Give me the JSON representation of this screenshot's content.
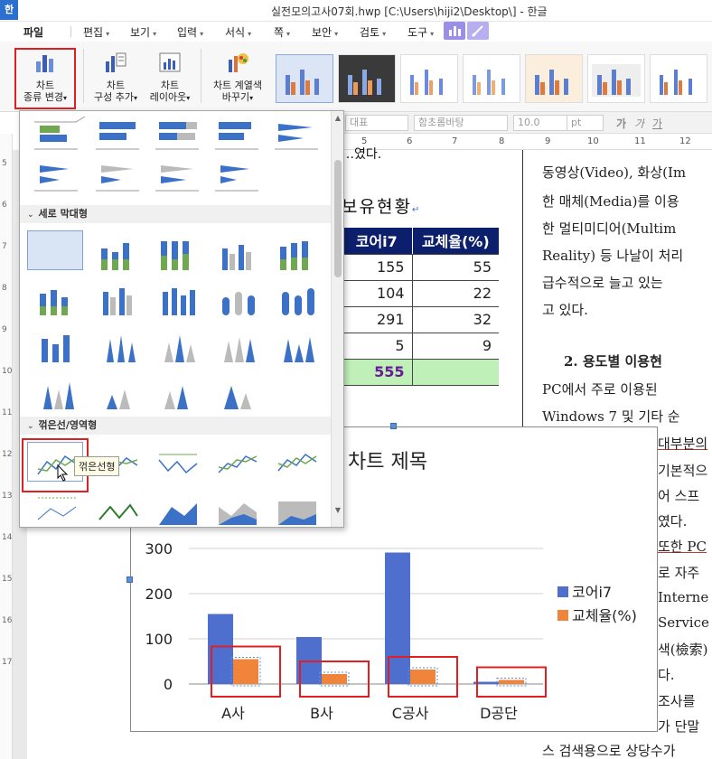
{
  "window": {
    "app_logo": "한",
    "title": "실전모의고사07회.hwp [C:\\Users\\hiji2\\Desktop\\] - 한글"
  },
  "menu": {
    "file": "파일",
    "items": [
      "편집",
      "보기",
      "입력",
      "서식",
      "쪽",
      "보안",
      "검토",
      "도구"
    ]
  },
  "ribbon": {
    "change_chart_type": "차트\n종류 변경",
    "add_component": "차트\n구성 추가",
    "layout": "차트\n레이아웃",
    "change_color": "차트 계열색\n바꾸기"
  },
  "format_bar": {
    "style": "대표",
    "font": "함초롬바탕",
    "size": "10.0",
    "unit": "pt",
    "glyphs": [
      "가",
      "가",
      "가"
    ]
  },
  "ruler": {
    "numbers": [
      "5",
      "6",
      "7",
      "8",
      "9",
      "10",
      "11",
      "12"
    ],
    "left_numbers": [
      "5",
      "6",
      "7",
      "8",
      "9",
      "10",
      "11",
      "12",
      "13",
      "14",
      "15",
      "16",
      "17"
    ]
  },
  "dropdown": {
    "section_column": "세로 막대형",
    "section_line": "꺾은선/영역형",
    "tooltip": "꺾은선형"
  },
  "document": {
    "heading": "보유현황",
    "heading_prefix_fragment": "…였다.",
    "table": {
      "headers": [
        "코어i7",
        "교체율(%)"
      ],
      "rows": [
        [
          "155",
          "55"
        ],
        [
          "104",
          "22"
        ],
        [
          "291",
          "32"
        ],
        [
          "5",
          "9"
        ]
      ],
      "total": [
        "555",
        ""
      ]
    },
    "right_column": [
      "동영상(Video), 화상(Im",
      "한 매체(Media)를 이용",
      "한  멀티미디어(Multim",
      "Reality) 등 나날이 처리",
      "급수적으로 늘고 있는 ",
      "고 있다."
    ],
    "section_heading": "2. 용도별 이용현",
    "right_column_2": [
      "PC에서  주로  이용된",
      "Windows 7 및 기타 순",
      "대부분의",
      "기본적으",
      "어  스프",
      "였다.",
      "또한 PC",
      "로 자주",
      "Interne",
      "Service",
      "색(檢索)",
      "다.",
      "조사를",
      "가 단말",
      "스 검색용으로 상당수가"
    ]
  },
  "chart_data": {
    "type": "bar",
    "title": "차트 제목",
    "categories": [
      "A사",
      "B사",
      "C공사",
      "D공단"
    ],
    "series": [
      {
        "name": "코어i7",
        "values": [
          155,
          104,
          291,
          5
        ],
        "color": "#4f6fcf"
      },
      {
        "name": "교체율(%)",
        "values": [
          55,
          22,
          32,
          9
        ],
        "color": "#f0843a"
      }
    ],
    "ylim": [
      0,
      300
    ],
    "yticks": [
      0,
      100,
      200,
      300
    ],
    "legend": "right",
    "grid": true
  },
  "colors": {
    "accent": "#2d6fcf",
    "table_header": "#0c1f6d",
    "table_total": "#bff0b8",
    "highlight": "#e02020"
  }
}
